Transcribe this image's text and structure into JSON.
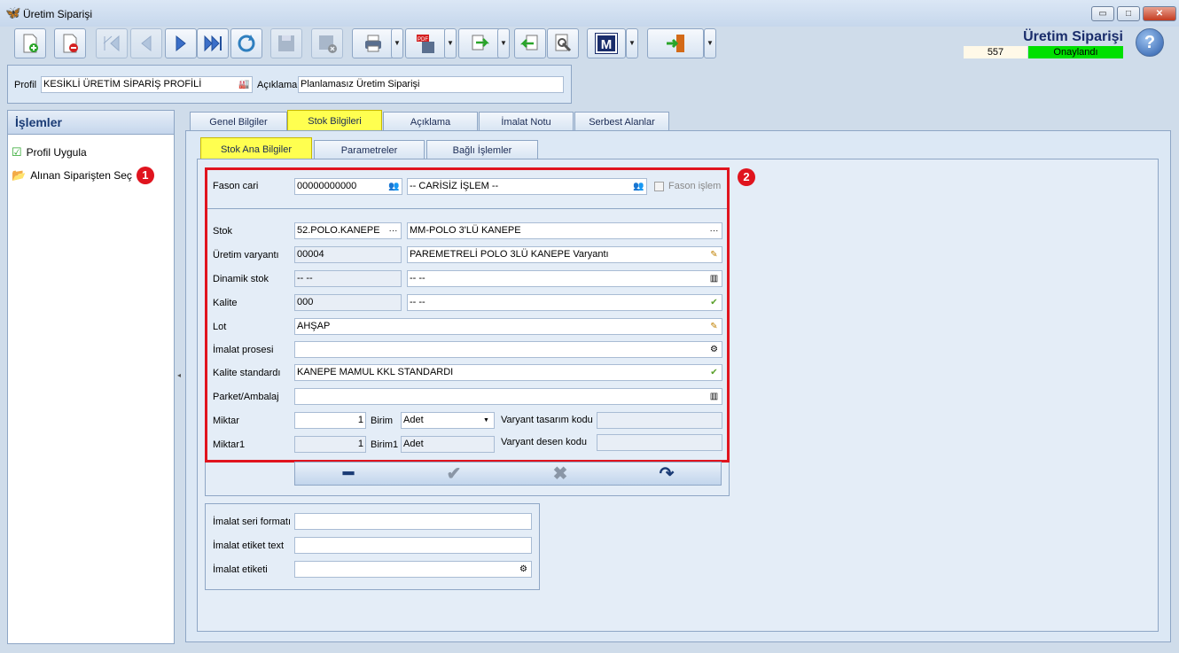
{
  "window": {
    "title": "Üretim Siparişi",
    "min": "▭",
    "max": "□",
    "close": "✕"
  },
  "header": {
    "doc_name": "Üretim Siparişi",
    "doc_no": "557",
    "status": "Onaylandı",
    "status_color": "#00e000"
  },
  "profile": {
    "profil_label": "Profil",
    "profil_value": "KESİKLİ ÜRETİM SİPARİŞ PROFİLİ",
    "aciklama_label": "Açıklama",
    "aciklama_value": "Planlamasız Üretim Siparişi"
  },
  "left_panel": {
    "title": "İşlemler",
    "items": [
      {
        "label": "Profil Uygula"
      },
      {
        "label": "Alınan Siparişten Seç",
        "badge": "1"
      }
    ]
  },
  "tabs": [
    "Genel Bilgiler",
    "Stok Bilgileri",
    "Açıklama",
    "İmalat Notu",
    "Serbest Alanlar"
  ],
  "subtabs": [
    "Stok Ana Bilgiler",
    "Parametreler",
    "Bağlı İşlemler"
  ],
  "badge2": "2",
  "form": {
    "fason_cari_label": "Fason cari",
    "fason_cari_code": "00000000000",
    "fason_cari_name": "-- CARİSİZ İŞLEM --",
    "fason_islem_label": "Fason işlem",
    "stok_label": "Stok",
    "stok_code": "52.POLO.KANEPE",
    "stok_name": "MM-POLO 3'LÜ KANEPE",
    "uretim_varyanti_label": "Üretim varyantı",
    "uretim_varyanti_code": "00004",
    "uretim_varyanti_name": "PAREMETRELİ POLO 3LÜ KANEPE Varyantı",
    "dinamik_stok_label": "Dinamik stok",
    "dinamik_stok_code": "-- --",
    "dinamik_stok_name": "-- --",
    "kalite_label": "Kalite",
    "kalite_code": "000",
    "kalite_name": "-- --",
    "lot_label": "Lot",
    "lot_value": "AHŞAP",
    "imalat_prosesi_label": "İmalat prosesi",
    "imalat_prosesi_value": "",
    "kalite_standardi_label": "Kalite standardı",
    "kalite_standardi_value": "KANEPE MAMUL KKL STANDARDI",
    "parket_label": "Parket/Ambalaj",
    "parket_value": "",
    "miktar_label": "Miktar",
    "miktar_value": "1",
    "birim_label": "Birim",
    "birim_value": "Adet",
    "varyant_tasarim_label": "Varyant tasarım kodu",
    "varyant_tasarim_value": "",
    "miktar1_label": "Miktar1",
    "miktar1_value": "1",
    "birim1_label": "Birim1",
    "birim1_value": "Adet",
    "varyant_desen_label": "Varyant desen kodu",
    "varyant_desen_value": ""
  },
  "lower_form": {
    "seri_label": "İmalat seri formatı",
    "seri_value": "",
    "etiket_text_label": "İmalat etiket text",
    "etiket_text_value": "",
    "etiket_label": "İmalat etiketi",
    "etiket_value": ""
  }
}
